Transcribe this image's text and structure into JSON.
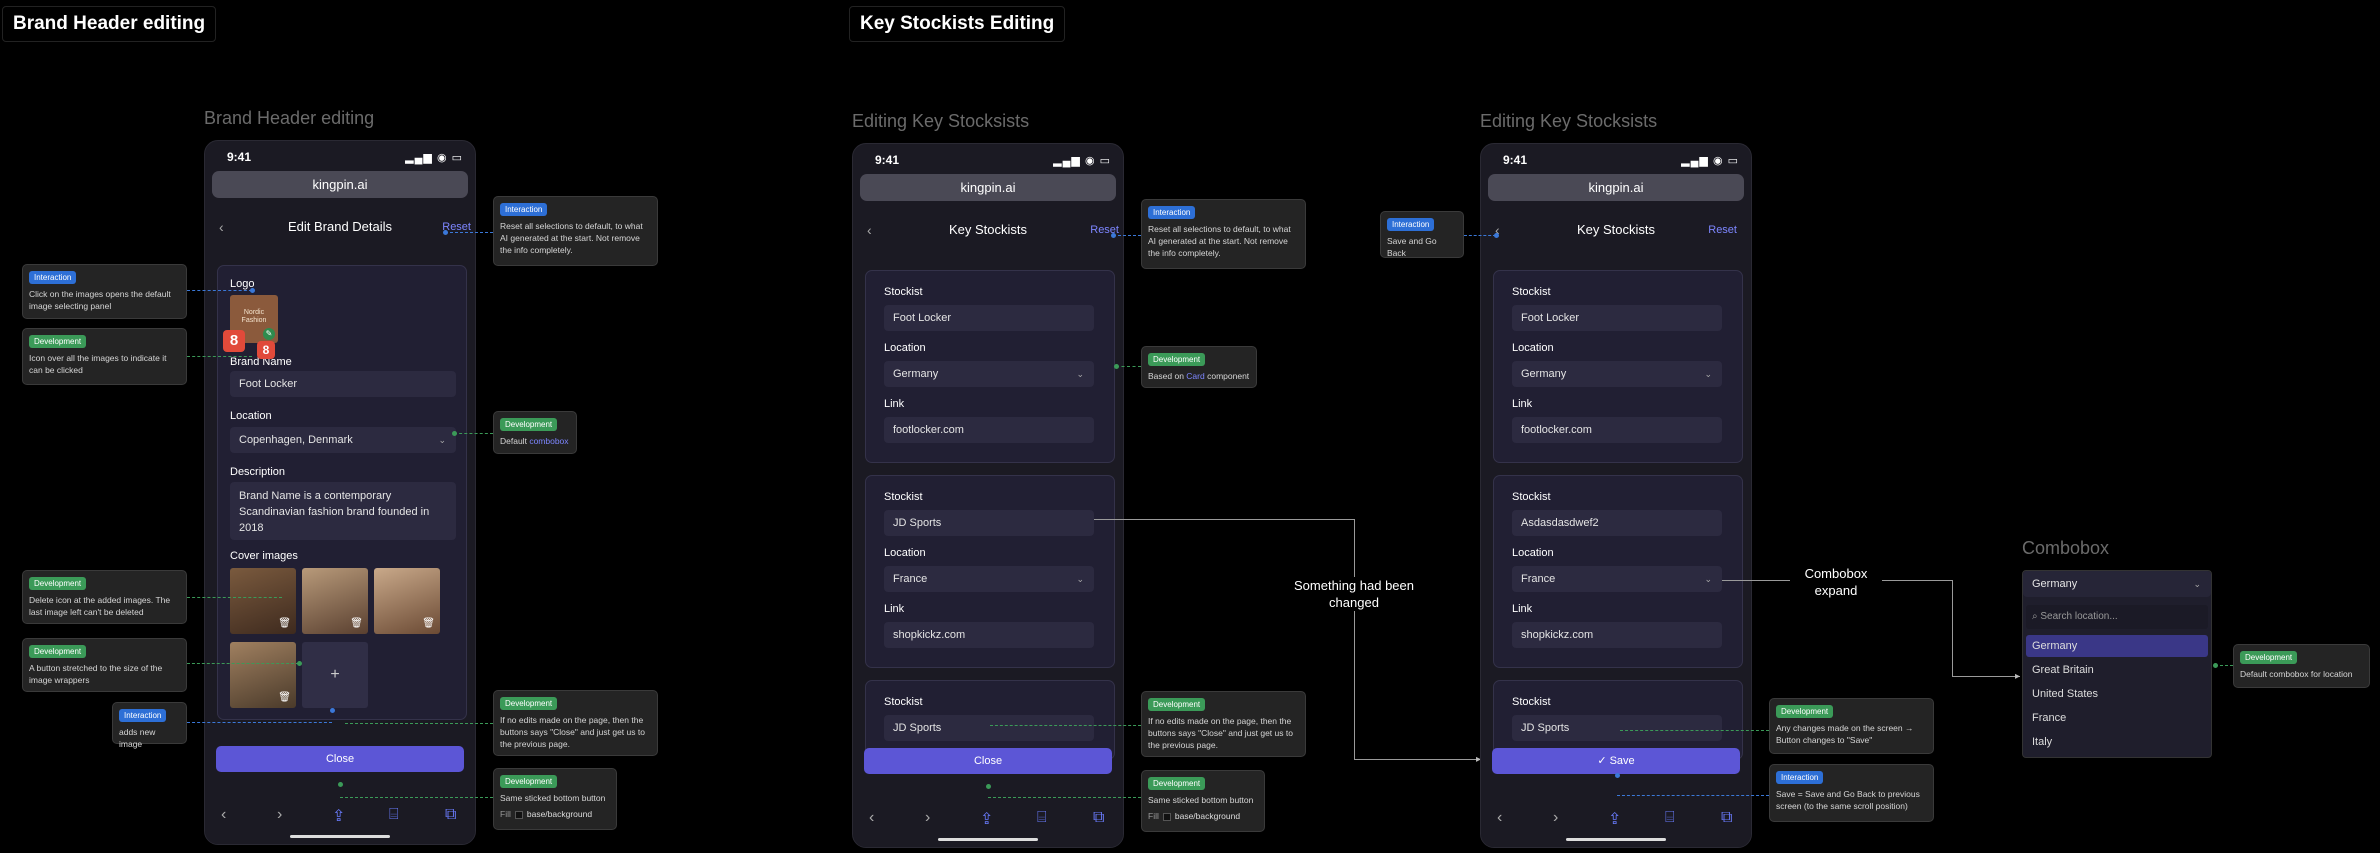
{
  "sections": {
    "brand_header": "Brand Header editing",
    "key_stockists": "Key Stockists Editing"
  },
  "frames": {
    "brand_title": "Brand Header editing",
    "stockists_title_1": "Editing Key Stocksists",
    "stockists_title_2": "Editing Key Stocksists",
    "combobox_title": "Combobox"
  },
  "status": {
    "time": "9:41",
    "icons": "▂▄▆ ◉ ▭"
  },
  "url": "kingpin.ai",
  "nav": {
    "back": "‹",
    "reset": "Reset"
  },
  "brand_screen": {
    "title": "Edit Brand Details",
    "logo_label": "Logo",
    "logo_text": "Nordic Fashion",
    "edit_badge": "8",
    "brand_name_label": "Brand Name",
    "brand_name_value": "Foot Locker",
    "location_label": "Location",
    "location_value": "Copenhagen, Denmark",
    "description_label": "Description",
    "description_value": "Brand Name is a contemporary Scandinavian fashion brand founded in 2018",
    "cover_label": "Cover images",
    "add_icon": "+",
    "close_label": "Close"
  },
  "stockists_screen": {
    "title": "Key Stockists",
    "stockist_label": "Stockist",
    "location_label": "Location",
    "link_label": "Link",
    "rows_1": [
      {
        "stockist": "Foot Locker",
        "location": "Germany",
        "link": "footlocker.com"
      },
      {
        "stockist": "JD Sports",
        "location": "France",
        "link": "shopkickz.com"
      },
      {
        "stockist": "JD Sports"
      }
    ],
    "rows_2": [
      {
        "stockist": "Foot Locker",
        "location": "Germany",
        "link": "footlocker.com"
      },
      {
        "stockist": "Asdasdasdwef2",
        "location": "France",
        "link": "shopkickz.com"
      },
      {
        "stockist": "JD Sports"
      }
    ],
    "close_label": "Close",
    "save_label": "Save"
  },
  "connectors": {
    "changed": "Something had been changed",
    "combobox_expand": "Combobox expand"
  },
  "combobox": {
    "selected": "Germany",
    "search_placeholder": "Search location...",
    "options": [
      "Germany",
      "Great Britain",
      "United States",
      "France",
      "Italy"
    ]
  },
  "notes": {
    "int_reset": {
      "badge": "Interaction",
      "text": "Reset all selections to default, to what AI generated at the start. Not remove the info completely."
    },
    "int_images": {
      "badge": "Interaction",
      "text": "Click on the images opens the default image selecting panel"
    },
    "dev_icon": {
      "badge": "Development",
      "text": "Icon over all the images to indicate it can be clicked"
    },
    "dev_combobox": {
      "badge": "Development",
      "text_a": "Default",
      "text_b": "combobox"
    },
    "dev_delete": {
      "badge": "Development",
      "text": "Delete icon at the added images. The last image left can't be deleted"
    },
    "dev_button": {
      "badge": "Development",
      "text": "A button stretched to the size of the image wrappers"
    },
    "int_adds": {
      "badge": "Interaction",
      "text": "adds new image"
    },
    "dev_no_edits": {
      "badge": "Development",
      "text": "If no edits made on the page, then the buttons says \"Close\" and just get us to the previous page."
    },
    "dev_sticky": {
      "badge": "Development",
      "text": "Same sticked bottom button",
      "fill_label": "Fill",
      "fill_value": "base/background"
    },
    "int_reset_2": {
      "badge": "Interaction",
      "text": "Reset all selections to default, to what AI generated at the start. Not remove the info completely."
    },
    "dev_card": {
      "badge": "Development",
      "text_a": "Based on",
      "text_b": "Card",
      "text_c": "component"
    },
    "dev_no_edits_2": {
      "badge": "Development",
      "text": "If no edits made on the page, then the buttons says \"Close\" and just get us to the previous page."
    },
    "dev_sticky_2": {
      "badge": "Development",
      "text": "Same sticked bottom button",
      "fill_label": "Fill",
      "fill_value": "base/background"
    },
    "int_save_back": {
      "badge": "Interaction",
      "text": "Save and Go Back"
    },
    "dev_changes": {
      "badge": "Development",
      "text": "Any changes made on the screen → Button changes to \"Save\""
    },
    "int_save": {
      "badge": "Interaction",
      "text": "Save = Save and Go Back to previous screen (to the same scroll position)"
    },
    "dev_default_combo": {
      "badge": "Development",
      "text": "Default combobox for location"
    }
  },
  "colors": {
    "accent": "#5c56d6",
    "interaction": "#2d6fd6",
    "development": "#3b9a58",
    "link": "#7d86ff"
  }
}
